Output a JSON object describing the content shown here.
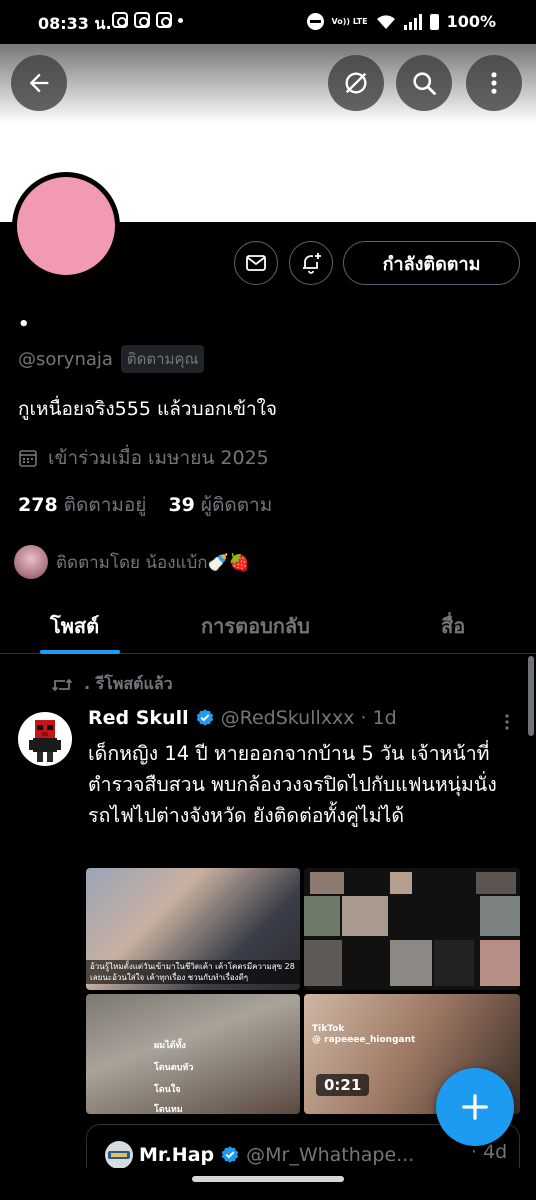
{
  "status_bar": {
    "time": "08:33 น.",
    "volte": "Vo)) LTE",
    "battery": "100%"
  },
  "header": {
    "back_icon": "arrow-left-icon",
    "translate_icon": "no-translate-icon",
    "search_icon": "search-icon",
    "more_icon": "more-vertical-icon"
  },
  "profile": {
    "display_name": "•",
    "handle": "@sorynaja",
    "follows_you": "ติดตามคุณ",
    "bio": "กูเหนื่อยจริง555 แล้วบอกเข้าใจ",
    "joined": "เข้าร่วมเมื่อ เมษายน 2025",
    "following_count": "278",
    "following_label": "ติดตามอยู่",
    "followers_count": "39",
    "followers_label": "ผู้ติดตาม",
    "followed_by": "ติดตามโดย น้องแบ้ก🍼🍓",
    "avatar_color": "#f39ab3",
    "following_button": "กำลังติดตาม"
  },
  "tabs": [
    {
      "label": "โพสต์",
      "active": true
    },
    {
      "label": "การตอบกลับ",
      "active": false
    },
    {
      "label": "สื่อ",
      "active": false
    }
  ],
  "post": {
    "repost_label": ". รีโพสต์แล้ว",
    "author_name": "Red Skull",
    "author_handle": "@RedSkullxxx",
    "dot": "·",
    "time": "1d",
    "text": "เด็กหญิง 14 ปี หายออกจากบ้าน 5 วัน เจ้าหน้าที่ตำรวจสืบสวน พบกล้องวงจรปิดไปกับแฟนหนุ่มนั่งรถไฟไปต่างจังหวัด ยังติดต่อทั้งคู่ไม่ได้",
    "media": {
      "m1_caption": "อ้วนรู้ไหมตั้งแต่วันเข้ามาในชีวิตเค้า เค้าโคตรมีความสุข 28 เลยนะอ้วนใส่ใจ เค้าทุกเรื่อง ชวนกับทำเรื่องดีๆ",
      "m3_lines": [
        "ผมได้ทั้ง",
        "โดนตบหัว",
        "โดนใจ",
        "โดนหม"
      ],
      "tiktok_label": "TikTok",
      "tiktok_handle": "@ rapeeee_hiongant",
      "video_duration": "0:21"
    }
  },
  "quote": {
    "author_name": "Mr.Hap",
    "author_handle": "@Mr_Whathape...",
    "dot": "·",
    "time": "4d"
  },
  "fab": {
    "icon": "plus-icon"
  },
  "colors": {
    "accent": "#1d9bf0",
    "background": "#000000",
    "muted_text": "#71767b",
    "border": "#2f3336"
  }
}
